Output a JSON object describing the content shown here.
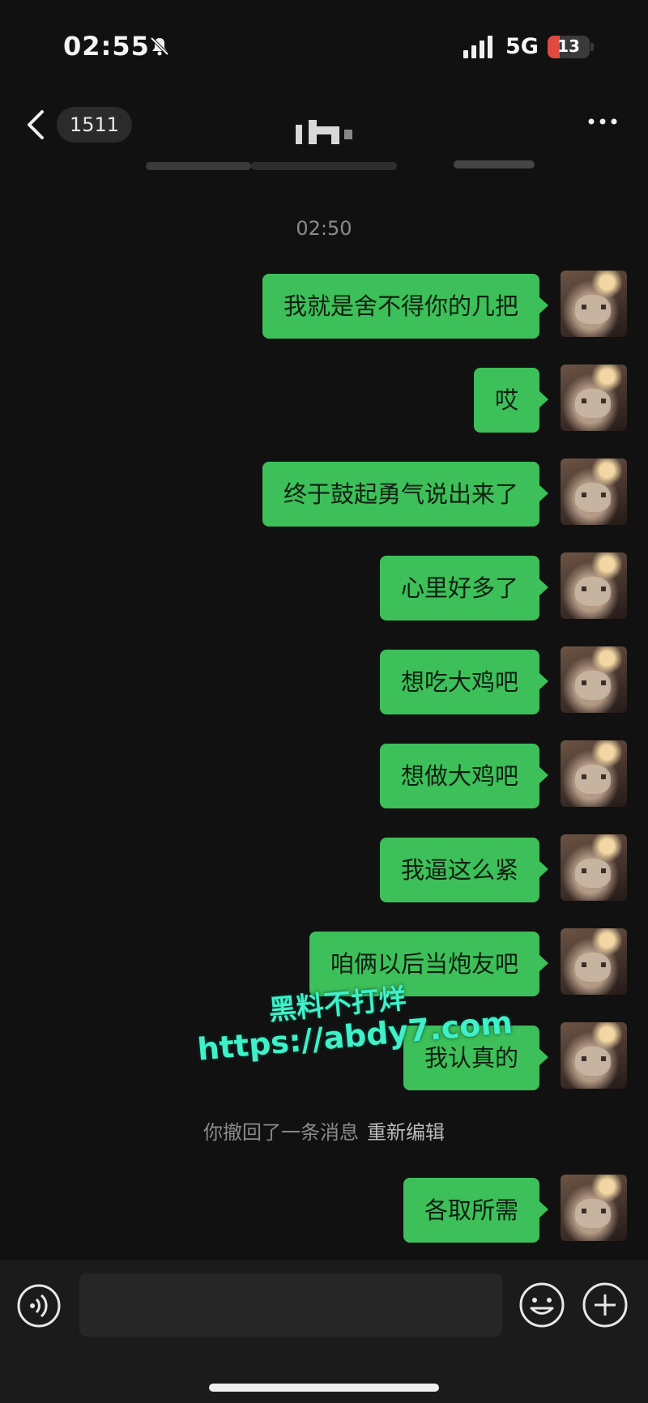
{
  "status_bar": {
    "time": "02:55",
    "network": "5G",
    "battery_percent": "13",
    "battery_level": 0.13,
    "icons": [
      "bell-muted-icon",
      "signal-bars-icon",
      "battery-icon"
    ]
  },
  "nav": {
    "unread_count": "1511",
    "icons": [
      "chevron-left-icon",
      "more-dots-icon"
    ]
  },
  "timestamp": "02:50",
  "messages": [
    "我就是舍不得你的几把",
    "哎",
    "终于鼓起勇气说出来了",
    "心里好多了",
    "想吃大鸡吧",
    "想做大鸡吧",
    "我逼这么紧",
    "咱俩以后当炮友吧",
    "我认真的"
  ],
  "recall_notice": {
    "text": "你撤回了一条消息",
    "action": "重新编辑"
  },
  "last_message": "各取所需",
  "watermark": {
    "line1": "黑料不打烊",
    "line2": "https://abdy7.com"
  },
  "input_bar": {
    "icons": [
      "voice-icon",
      "emoji-icon",
      "plus-icon"
    ]
  },
  "colors": {
    "bubble": "#3dbf59",
    "background": "#111111",
    "watermark": "#3ff0c8",
    "battery_low": "#e04a3f"
  }
}
